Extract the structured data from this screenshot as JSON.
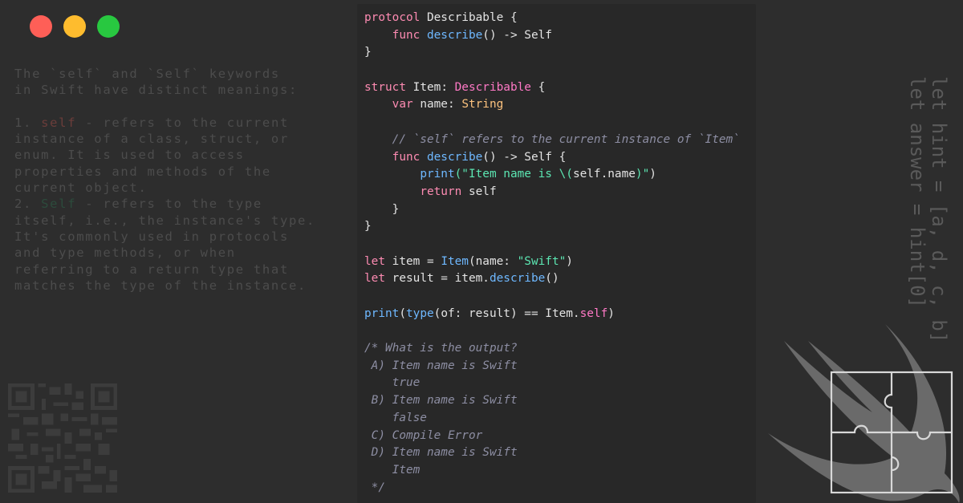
{
  "colors": {
    "background": "#2d2d2d",
    "code_panel": "#282828",
    "keyword": "#fd8bb2",
    "type": "#fcc27e",
    "function": "#6eb8ff",
    "string": "#5ce6b2",
    "comment": "#8d8ea3"
  },
  "window_controls": [
    "close-button",
    "minimize-button",
    "zoom-button"
  ],
  "explanation": {
    "intro": "The `self` and `Self` keywords\nin Swift have distinct meanings:",
    "item1_num": "1. ",
    "item1_kw": "self",
    "item1_rest": " - refers to the current\ninstance of a class, struct, or\nenum. It is used to access\nproperties and methods of the\ncurrent object.",
    "item2_num": "2. ",
    "item2_kw": "Self",
    "item2_rest": " - refers to the type\nitself, i.e., the instance's type.\nIt's commonly used in protocols\nand type methods, or when\nreferring to a return type that\nmatches the type of the instance."
  },
  "code": {
    "protocol_kw": "protocol",
    "protocol_name": "Describable",
    "open_brace": " {",
    "func_kw": "func",
    "describe": "describe",
    "parens_ret": "() -> Self",
    "close_brace": "}",
    "struct_kw": "struct",
    "struct_name": "Item",
    "colon": ": ",
    "conforms": "Describable",
    "var_kw": "var",
    "name_decl": " name: ",
    "string_type": "String",
    "comment_self": "// `self` refers to the current instance of `Item`",
    "parens_ret_open": "() -> Self {",
    "print_fn": "print",
    "str_open": "(\"Item name is ",
    "interp_open": "\\(",
    "self_kw": "self",
    "dot_name": ".name",
    "interp_close": ")\"",
    "close_paren": ")",
    "return_kw": "return",
    "return_self": " self",
    "let_kw": "let",
    "item_decl": " item = ",
    "item_type": "Item",
    "init_open": "(name: ",
    "swift_str": "\"Swift\"",
    "result_decl": " result = item.",
    "describe_call": "describe",
    "empty_call": "()",
    "type_fn": "type",
    "of_label": "(of: result) == Item.",
    "self_kw2": "self",
    "question": "/* What is the output?",
    "opt_a1": " A) Item name is Swift",
    "opt_a2": "    true",
    "opt_b1": " B) Item name is Swift",
    "opt_b2": "    false",
    "opt_c": " C) Compile Error",
    "opt_d1": " D) Item name is Swift",
    "opt_d2": "    Item",
    "comment_end": " */"
  },
  "vertical_text": {
    "line1": "let hint = [a, d, c, b]",
    "line2": "let answer = hint[0]"
  },
  "icons": [
    "qr-code-icon",
    "swift-logo-icon",
    "puzzle-icon"
  ]
}
